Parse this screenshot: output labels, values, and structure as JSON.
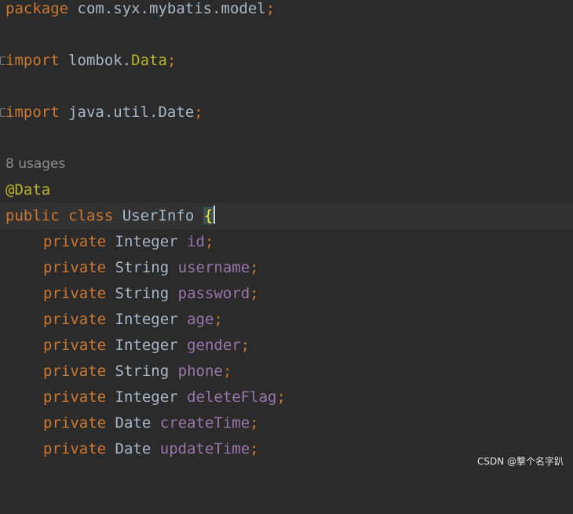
{
  "editor": {
    "package_line": {
      "keyword": "package",
      "name": "com.syx.mybatis.model",
      "semicolon": ";"
    },
    "import1": {
      "keyword": "import",
      "prefix": "lombok.",
      "cls": "Data",
      "semicolon": ";"
    },
    "import2": {
      "keyword": "import",
      "prefix": "java.util.",
      "cls": "Date",
      "semicolon": ";"
    },
    "usages_hint": "8 usages",
    "annotation": "@Data",
    "class_decl": {
      "public_kw": "public",
      "class_kw": "class",
      "name": "UserInfo",
      "brace": "{"
    },
    "fields": [
      {
        "modifier": "private",
        "type": "Integer",
        "name": "id",
        "semicolon": ";"
      },
      {
        "modifier": "private",
        "type": "String",
        "name": "username",
        "semicolon": ";"
      },
      {
        "modifier": "private",
        "type": "String",
        "name": "password",
        "semicolon": ";"
      },
      {
        "modifier": "private",
        "type": "Integer",
        "name": "age",
        "semicolon": ";"
      },
      {
        "modifier": "private",
        "type": "Integer",
        "name": "gender",
        "semicolon": ";"
      },
      {
        "modifier": "private",
        "type": "String",
        "name": "phone",
        "semicolon": ";"
      },
      {
        "modifier": "private",
        "type": "Integer",
        "name": "deleteFlag",
        "semicolon": ";"
      },
      {
        "modifier": "private",
        "type": "Date",
        "name": "createTime",
        "semicolon": ";"
      },
      {
        "modifier": "private",
        "type": "Date",
        "name": "updateTime",
        "semicolon": ";"
      }
    ]
  },
  "watermark": "CSDN @撃个名字趴",
  "colors": {
    "background": "#2b2b2b",
    "keyword": "#cc7832",
    "annotation": "#bbb529",
    "field": "#9876aa",
    "text": "#a9b7c6",
    "hint": "#8c8c8c",
    "brace_highlight": "#ffef28"
  }
}
